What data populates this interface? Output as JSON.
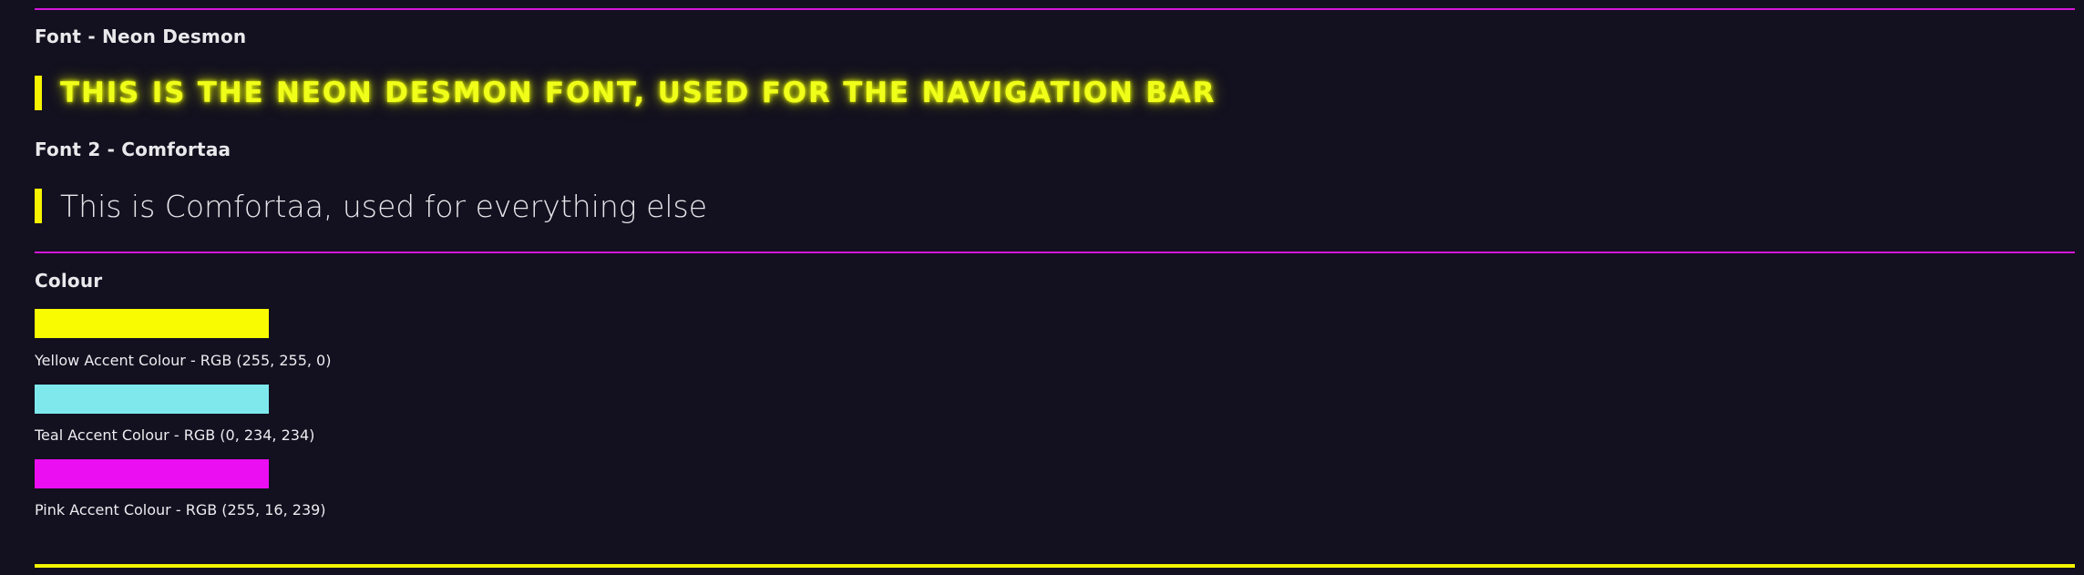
{
  "fonts_section": {
    "font1_title": "Font - Neon Desmon",
    "font1_sample": "THIS IS THE NEON DESMON FONT, USED FOR THE NAVIGATION BAR",
    "font2_title": "Font 2 - Comfortaa",
    "font2_sample": "This is Comfortaa, used for everything else"
  },
  "colour_section": {
    "title": "Colour",
    "swatches": [
      {
        "label": "Yellow Accent Colour - RGB (255, 255, 0)",
        "color": "#f9fb00"
      },
      {
        "label": "Teal Accent Colour - RGB (0, 234, 234)",
        "color": "#7ee8ec"
      },
      {
        "label": "Pink Accent Colour - RGB (255, 16, 239)",
        "color": "#ec0ef2"
      }
    ]
  },
  "theme": {
    "background": "#13101f",
    "divider_pink": "#d417d8",
    "divider_yellow": "#f3f500",
    "quote_bar": "#f7f400"
  }
}
